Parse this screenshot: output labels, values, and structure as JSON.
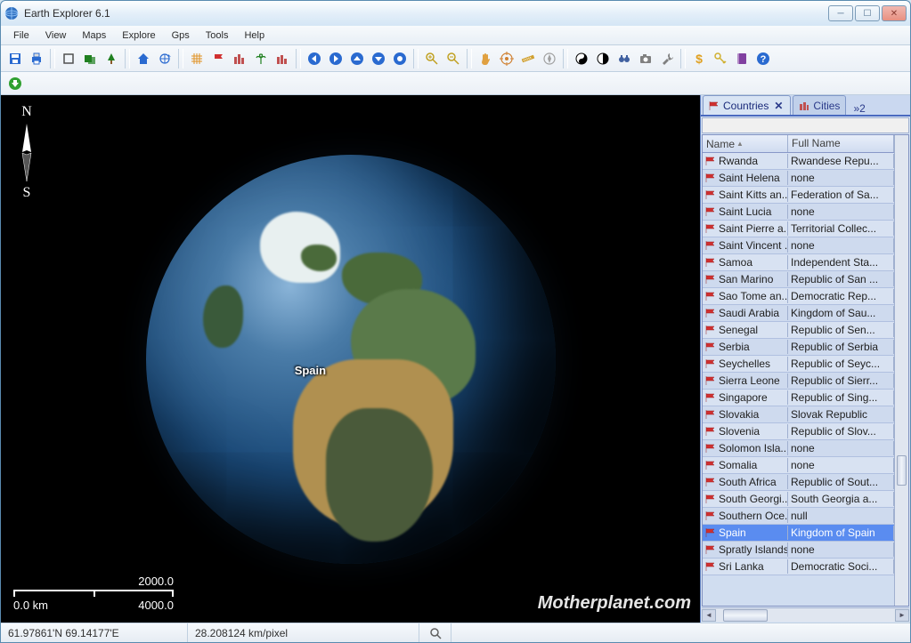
{
  "window": {
    "title": "Earth Explorer 6.1"
  },
  "menu": [
    "File",
    "View",
    "Maps",
    "Explore",
    "Gps",
    "Tools",
    "Help"
  ],
  "toolbar_icons": [
    {
      "name": "save-icon",
      "color": "#2a6ad0"
    },
    {
      "name": "print-icon",
      "color": "#2a6ad0"
    },
    {
      "sep": true
    },
    {
      "name": "rect-icon",
      "color": "#505050"
    },
    {
      "name": "layers-icon",
      "color": "#208020"
    },
    {
      "name": "tree-icon",
      "color": "#208020"
    },
    {
      "sep": true
    },
    {
      "name": "home-icon",
      "color": "#2a6ad0"
    },
    {
      "name": "globe-nav-icon",
      "color": "#2a6ad0"
    },
    {
      "sep": true
    },
    {
      "name": "grid-icon",
      "color": "#e09020"
    },
    {
      "name": "flag-icon",
      "color": "#d03030"
    },
    {
      "name": "city-icon",
      "color": "#c05050"
    },
    {
      "name": "palm-icon",
      "color": "#208020"
    },
    {
      "name": "layers2-icon",
      "color": "#c05050"
    },
    {
      "sep": true
    },
    {
      "name": "nav-left-icon",
      "color": "#2a6ad0"
    },
    {
      "name": "nav-right-icon",
      "color": "#2a6ad0"
    },
    {
      "name": "nav-up-icon",
      "color": "#2a6ad0"
    },
    {
      "name": "nav-down-icon",
      "color": "#2a6ad0"
    },
    {
      "name": "nav-center-icon",
      "color": "#2a6ad0"
    },
    {
      "sep": true
    },
    {
      "name": "zoom-in-icon",
      "color": "#c0a020"
    },
    {
      "name": "zoom-out-icon",
      "color": "#c0a020"
    },
    {
      "sep": true
    },
    {
      "name": "hand-icon",
      "color": "#e0a040"
    },
    {
      "name": "target-icon",
      "color": "#d08030"
    },
    {
      "name": "ruler-icon",
      "color": "#d0a030"
    },
    {
      "name": "compass-icon",
      "color": "#a0a0a0"
    },
    {
      "sep": true
    },
    {
      "name": "yinyang-icon",
      "color": "#202020"
    },
    {
      "name": "contrast-icon",
      "color": "#202020"
    },
    {
      "name": "binoculars-icon",
      "color": "#4060a0"
    },
    {
      "name": "camera-icon",
      "color": "#808080"
    },
    {
      "name": "tools-icon",
      "color": "#808080"
    },
    {
      "sep": true
    },
    {
      "name": "dollar-icon",
      "color": "#e0a020"
    },
    {
      "name": "key-icon",
      "color": "#d0b030"
    },
    {
      "name": "book-icon",
      "color": "#8040a0"
    },
    {
      "name": "help-icon",
      "color": "#2a6ad0"
    }
  ],
  "toolbar2_icons": [
    {
      "name": "download-icon",
      "color": "#30a030"
    }
  ],
  "map": {
    "compass_n": "N",
    "compass_s": "S",
    "label": "Spain",
    "watermark": "Motherplanet.com",
    "scale": {
      "top_left": "",
      "top_right": "2000.0",
      "bot_left": "0.0 km",
      "bot_right": "4000.0"
    }
  },
  "panel": {
    "tabs": {
      "countries": "Countries",
      "cities": "Cities",
      "more": "2"
    },
    "columns": [
      "Name",
      "Full Name"
    ],
    "selected": "Spain",
    "rows": [
      {
        "name": "Rwanda",
        "full": "Rwandese Repu..."
      },
      {
        "name": "Saint Helena",
        "full": "none"
      },
      {
        "name": "Saint Kitts an...",
        "full": "Federation of Sa..."
      },
      {
        "name": "Saint Lucia",
        "full": "none"
      },
      {
        "name": "Saint Pierre a...",
        "full": "Territorial Collec..."
      },
      {
        "name": "Saint Vincent ...",
        "full": "none"
      },
      {
        "name": "Samoa",
        "full": "Independent Sta..."
      },
      {
        "name": "San Marino",
        "full": "Republic of San ..."
      },
      {
        "name": "Sao Tome an...",
        "full": "Democratic Rep..."
      },
      {
        "name": "Saudi Arabia",
        "full": "Kingdom of Sau..."
      },
      {
        "name": "Senegal",
        "full": "Republic of Sen..."
      },
      {
        "name": "Serbia",
        "full": "Republic of Serbia"
      },
      {
        "name": "Seychelles",
        "full": "Republic of Seyc..."
      },
      {
        "name": "Sierra Leone",
        "full": "Republic of Sierr..."
      },
      {
        "name": "Singapore",
        "full": "Republic of Sing..."
      },
      {
        "name": "Slovakia",
        "full": "Slovak Republic"
      },
      {
        "name": "Slovenia",
        "full": "Republic of Slov..."
      },
      {
        "name": "Solomon Isla...",
        "full": "none"
      },
      {
        "name": "Somalia",
        "full": "none"
      },
      {
        "name": "South Africa",
        "full": "Republic of Sout..."
      },
      {
        "name": "South Georgi...",
        "full": "South Georgia a..."
      },
      {
        "name": "Southern Oce...",
        "full": "null"
      },
      {
        "name": "Spain",
        "full": "Kingdom of Spain"
      },
      {
        "name": "Spratly Islands",
        "full": "none"
      },
      {
        "name": "Sri Lanka",
        "full": "Democratic Soci..."
      }
    ]
  },
  "status": {
    "coords": "61.97861'N  69.14177'E",
    "scale": "28.208124 km/pixel"
  }
}
